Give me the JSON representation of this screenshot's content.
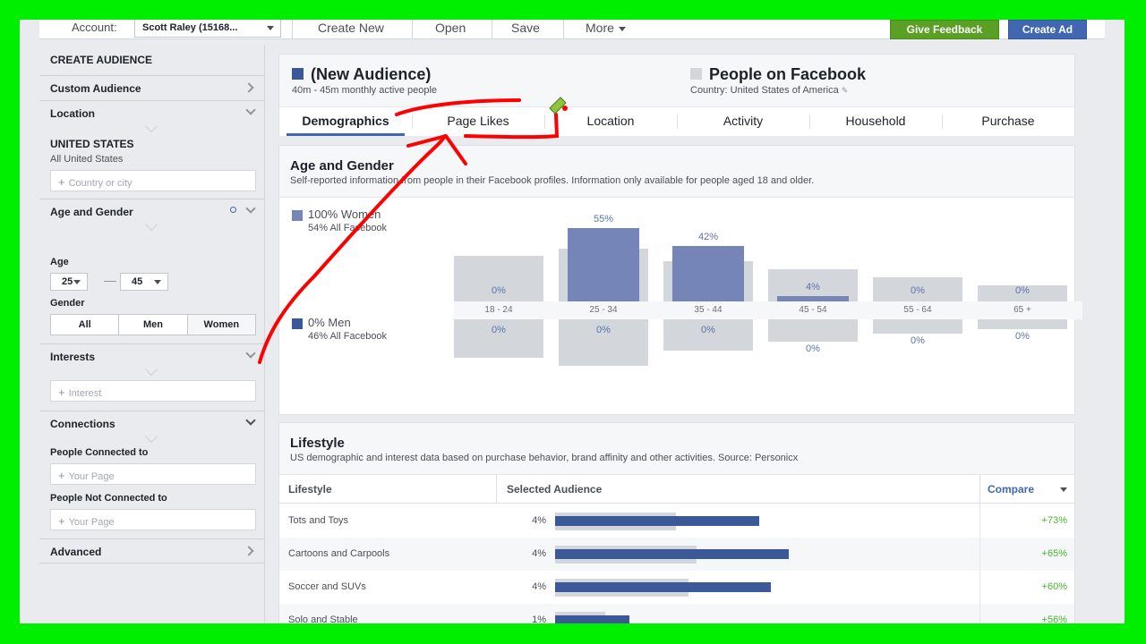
{
  "topbar": {
    "account_label": "Account:",
    "account_value": "Scott Raley (15168...",
    "menu": [
      "Create New",
      "Open",
      "Save",
      "More"
    ],
    "give_feedback": "Give Feedback",
    "create_ad": "Create Ad",
    "colors": {
      "feedback": "#5aa024",
      "create_ad": "#4267b2"
    }
  },
  "sidebar": {
    "title": "CREATE AUDIENCE",
    "custom_audience": "Custom Audience",
    "location": {
      "label": "Location",
      "country": "UNITED STATES",
      "country_sub": "All United States",
      "placeholder": "Country or city"
    },
    "age_gender": {
      "label": "Age and Gender",
      "age_label": "Age",
      "age_min": "25",
      "age_max": "45",
      "gender_label": "Gender",
      "gender_options": [
        "All",
        "Men",
        "Women"
      ],
      "selected_gender": "Women"
    },
    "interests": {
      "label": "Interests",
      "placeholder": "Interest"
    },
    "connections": {
      "label": "Connections",
      "connected_label": "People Connected to",
      "connected_placeholder": "Your Page",
      "not_connected_label": "People Not Connected to",
      "not_connected_placeholder": "Your Page"
    },
    "advanced": "Advanced"
  },
  "header": {
    "audience_title": "(New Audience)",
    "audience_sub": "40m - 45m monthly active people",
    "fb_title": "People on Facebook",
    "fb_sub": "Country: United States of America",
    "colors": {
      "audience": "#3b5998",
      "facebook": "#d3d6db"
    },
    "tabs": [
      "Demographics",
      "Page Likes",
      "Location",
      "Activity",
      "Household",
      "Purchase"
    ],
    "active_tab": "Demographics"
  },
  "age_gender_card": {
    "title": "Age and Gender",
    "description": "Self-reported information from people in their Facebook profiles. Information only available for people aged 18 and older.",
    "women_label": "100% Women",
    "women_sub": "54% All Facebook",
    "men_label": "0% Men",
    "men_sub": "46% All Facebook",
    "groups": [
      {
        "label": "18 - 24",
        "women_pct": "0%",
        "men_pct": "0%",
        "women": 0,
        "fb_women": 0.62,
        "fb_men": 0.72
      },
      {
        "label": "25 - 34",
        "women_pct": "55%",
        "men_pct": "0%",
        "women": 1.0,
        "fb_women": 0.72,
        "fb_men": 0.86
      },
      {
        "label": "35 - 44",
        "women_pct": "42%",
        "men_pct": "0%",
        "women": 0.76,
        "fb_women": 0.55,
        "fb_men": 0.59
      },
      {
        "label": "45 - 54",
        "women_pct": "4%",
        "men_pct": "0%",
        "women": 0.07,
        "fb_women": 0.44,
        "fb_men": 0.41
      },
      {
        "label": "55 - 64",
        "women_pct": "0%",
        "men_pct": "0%",
        "women": 0,
        "fb_women": 0.33,
        "fb_men": 0.27
      },
      {
        "label": "65 +",
        "women_pct": "0%",
        "men_pct": "0%",
        "women": 0,
        "fb_women": 0.22,
        "fb_men": 0.18
      }
    ]
  },
  "lifestyle_card": {
    "title": "Lifestyle",
    "description": "US demographic and interest data based on purchase behavior, brand affinity and other activities. Source: Personicx",
    "columns": [
      "Lifestyle",
      "Selected Audience",
      "Compare"
    ],
    "rows": [
      {
        "name": "Tots and Toys",
        "pct": "4%",
        "audience": 0.69,
        "facebook": 0.41,
        "compare": "+73%"
      },
      {
        "name": "Cartoons and Carpools",
        "pct": "4%",
        "audience": 0.79,
        "facebook": 0.48,
        "compare": "+65%"
      },
      {
        "name": "Soccer and SUVs",
        "pct": "4%",
        "audience": 0.73,
        "facebook": 0.45,
        "compare": "+60%"
      },
      {
        "name": "Solo and Stable",
        "pct": "1%",
        "audience": 0.25,
        "facebook": 0.17,
        "compare": "+56%"
      }
    ]
  },
  "annotation": {
    "color": "#ff0000"
  }
}
